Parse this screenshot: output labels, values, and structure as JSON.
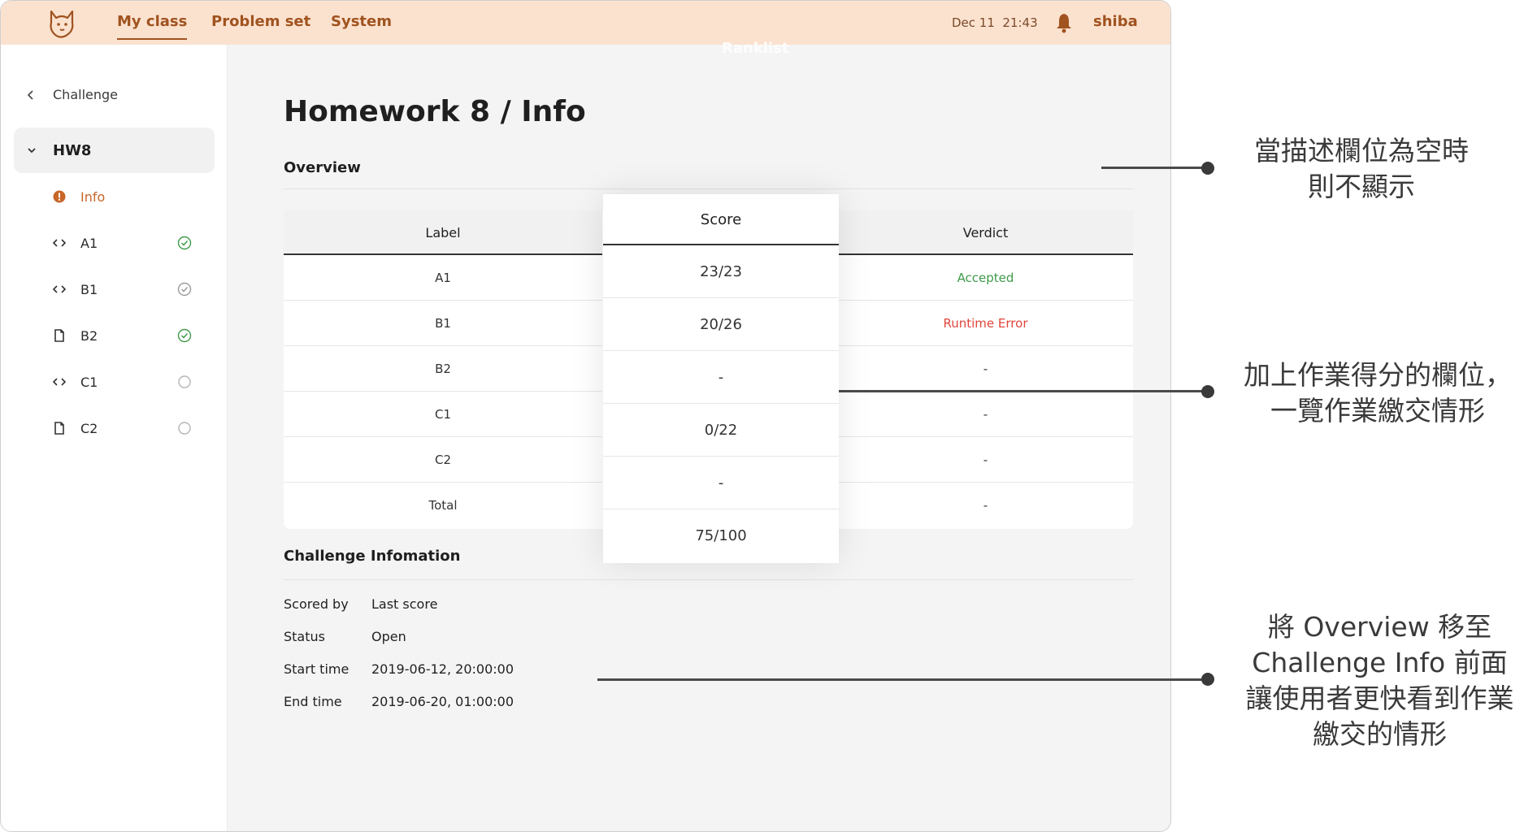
{
  "nav": {
    "items": [
      "My class",
      "Problem set",
      "System"
    ],
    "datetime": "Dec 11  21:43",
    "username": "shiba",
    "ghost_tab": "Ranklist"
  },
  "sidebar": {
    "back_label": "Challenge",
    "group_label": "HW8",
    "items": [
      {
        "label": "Info",
        "icon": "info-icon",
        "status": ""
      },
      {
        "label": "A1",
        "icon": "code-icon",
        "status": "accepted"
      },
      {
        "label": "B1",
        "icon": "code-icon",
        "status": "submitted"
      },
      {
        "label": "B2",
        "icon": "file-icon",
        "status": "accepted"
      },
      {
        "label": "C1",
        "icon": "code-icon",
        "status": "none"
      },
      {
        "label": "C2",
        "icon": "file-icon",
        "status": "none"
      }
    ]
  },
  "main": {
    "title": "Homework 8 / Info",
    "overview_title": "Overview",
    "table": {
      "headers": [
        "Label",
        "Score",
        "Verdict"
      ],
      "rows": [
        {
          "label": "A1",
          "score": "23/23",
          "verdict": "Accepted"
        },
        {
          "label": "B1",
          "score": "20/26",
          "verdict": "Runtime Error"
        },
        {
          "label": "B2",
          "score": "-",
          "verdict": "-"
        },
        {
          "label": "C1",
          "score": "0/22",
          "verdict": "-"
        },
        {
          "label": "C2",
          "score": "-",
          "verdict": "-"
        },
        {
          "label": "Total",
          "score": "75/100",
          "verdict": "-"
        }
      ]
    },
    "challenge_info_title": "Challenge Infomation",
    "info": [
      {
        "key": "Scored by",
        "value": "Last score"
      },
      {
        "key": "Status",
        "value": "Open"
      },
      {
        "key": "Start time",
        "value": "2019-06-12, 20:00:00"
      },
      {
        "key": "End time",
        "value": "2019-06-20, 01:00:00"
      }
    ]
  },
  "annotations": [
    {
      "lines": [
        "當描述欄位為空時",
        "則不顯示"
      ]
    },
    {
      "lines": [
        "加上作業得分的欄位，",
        "一覽作業繳交情形"
      ]
    },
    {
      "lines": [
        "將 Overview 移至",
        "Challenge Info 前面",
        "讓使用者更快看到作業",
        "繳交的情形"
      ]
    }
  ],
  "colors": {
    "topbar": "#fbe2cf",
    "brand": "#a0531f",
    "accent_active": "#c7672a",
    "accepted": "#3f9a4a",
    "error": "#e0463b"
  }
}
